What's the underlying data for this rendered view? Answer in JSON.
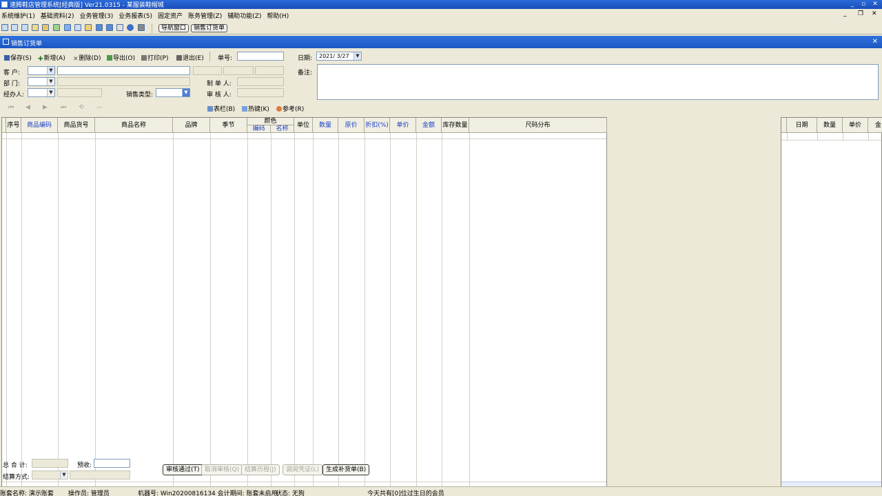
{
  "window": {
    "title": "速腾鞋店管理系统[经典版] Ver21.0315 - 某服装鞋帽城",
    "min": "_",
    "max": "▫",
    "close": "✕"
  },
  "menu": [
    "系统维护(1)",
    "基础资料(2)",
    "业务管理(3)",
    "业务报表(5)",
    "固定资产",
    "账务管理(Z)",
    "辅助功能(Z)",
    "帮助(H)"
  ],
  "mdi_controls": {
    "min": "_",
    "restore": "❐",
    "close": "✕"
  },
  "toolbar": {
    "nav_window": "导航窗口",
    "sales_order": "销售订货单"
  },
  "form": {
    "title": "销售订货单",
    "close": "✕",
    "actions": {
      "save": "保存(S)",
      "new": "新增(A)",
      "delete": "删除(D)",
      "export": "导出(O)",
      "print": "打印(P)",
      "exit": "退出(E)"
    },
    "order_no_label": "单号:",
    "order_no_value": "",
    "date_label": "日期:",
    "date_value": "2021/ 3/27",
    "customer_label": "客  户:",
    "department_label": "部  门:",
    "handler_label": "经办人:",
    "sales_type_label": "销售类型:",
    "creator_label": "制 单 人:",
    "reviewer_label": "审 核 人:",
    "remarks_label": "备注:",
    "nav_glyphs": [
      "⏮",
      "◀",
      "▶",
      "⏭",
      "⟲",
      "—"
    ],
    "sub_actions": {
      "columns": "表栏(B)",
      "hotkey": "热键(K)",
      "reference": "参考(R)"
    }
  },
  "grid": {
    "headers": [
      "序号",
      "商品编码",
      "商品货号",
      "商品名称",
      "品牌",
      "季节",
      "颜色",
      "单位",
      "数量",
      "原价",
      "折扣(%)",
      "单价",
      "金额",
      "库存数量",
      "尺码分布"
    ],
    "color_sub": [
      "编码",
      "名称"
    ]
  },
  "side_grid": {
    "headers": [
      "日期",
      "数量",
      "单价",
      "金"
    ]
  },
  "footer": {
    "total_label": "总 合 计:",
    "prepaid_label": "预收:",
    "settle_label": "结算方式:",
    "buttons": {
      "approve": "审核通过(T)",
      "cancel_approve": "取消审核(Q)",
      "settle_history": "结算历程(J)",
      "call_voucher": "调阅凭证(L)",
      "gen_replenish": "生成补货单(B)"
    }
  },
  "status": {
    "account": "账套名称: 演示账套",
    "operator": "操作员: 管理员",
    "machine": "机器号: Win20200816134 会计期间: 账套未启用",
    "state": "状态: 无狗",
    "birthday": "今天共有[0]位过生日的会员"
  }
}
